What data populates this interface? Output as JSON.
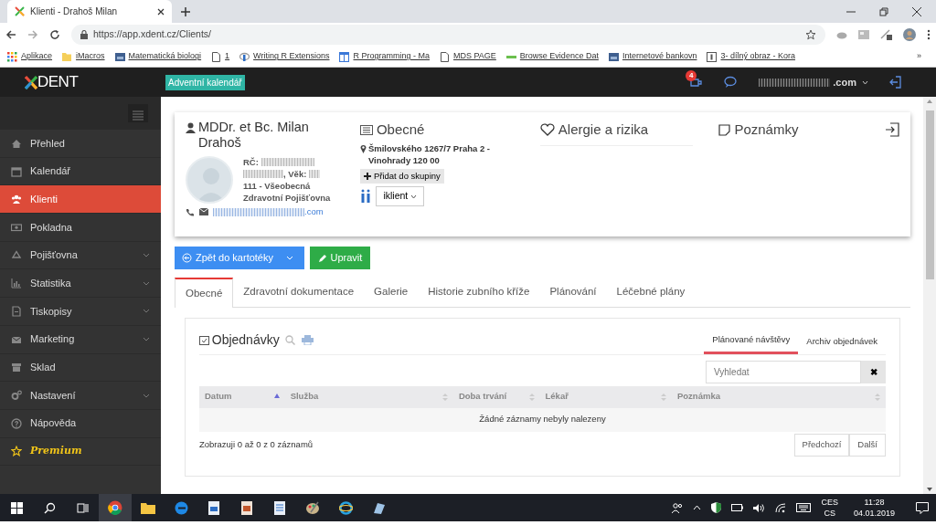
{
  "browser": {
    "tab_title": "Klienti - Drahoš Milan",
    "url": "https://app.xdent.cz/Clients/",
    "bookmarks": [
      "Aplikace",
      "iMacros",
      "Matematická biologi",
      "1",
      "Writing R Extensions",
      "R Programming - Ma",
      "MDS PAGE",
      "Browse Evidence Dat",
      "Internetové bankovn",
      "3- dílný obraz - Kora"
    ],
    "overflow": "»"
  },
  "app": {
    "logo_text": "DENT",
    "banner": "Adventní kalendář",
    "notification_count": "4",
    "user_suffix": ".com"
  },
  "sidebar": {
    "items": [
      {
        "label": "Přehled",
        "selected": false,
        "expandable": false
      },
      {
        "label": "Kalendář",
        "selected": false,
        "expandable": false
      },
      {
        "label": "Klienti",
        "selected": true,
        "expandable": false
      },
      {
        "label": "Pokladna",
        "selected": false,
        "expandable": false
      },
      {
        "label": "Pojišťovna",
        "selected": false,
        "expandable": true
      },
      {
        "label": "Statistika",
        "selected": false,
        "expandable": true
      },
      {
        "label": "Tiskopisy",
        "selected": false,
        "expandable": true
      },
      {
        "label": "Marketing",
        "selected": false,
        "expandable": true
      },
      {
        "label": "Sklad",
        "selected": false,
        "expandable": false
      },
      {
        "label": "Nastavení",
        "selected": false,
        "expandable": true
      },
      {
        "label": "Nápověda",
        "selected": false,
        "expandable": false
      },
      {
        "label": "Premium",
        "selected": false,
        "expandable": false,
        "kind": "premium"
      }
    ]
  },
  "client": {
    "name": "MDDr. et Bc. Milan Drahoš",
    "rc_label": "RČ:",
    "age_label": ", Věk:",
    "insurance": "111 - Všeobecná Zdravotní Pojišťovna",
    "email_suffix": ".com",
    "general": {
      "heading": "Obecné",
      "address": "Šmilovského 1267/7 Praha 2 - Vinohrady 120 00",
      "group_button": "Přidat do skupiny",
      "client_type": "iklient"
    },
    "allergies": {
      "heading": "Alergie a rizika"
    },
    "notes": {
      "heading": "Poznámky"
    }
  },
  "actions": {
    "back": "Zpět do kartotéky",
    "edit": "Upravit"
  },
  "tabs": [
    {
      "label": "Obecné",
      "selected": true
    },
    {
      "label": "Zdravotní dokumentace",
      "selected": false
    },
    {
      "label": "Galerie",
      "selected": false
    },
    {
      "label": "Historie zubního kříže",
      "selected": false
    },
    {
      "label": "Plánování",
      "selected": false
    },
    {
      "label": "Léčebné plány",
      "selected": false
    }
  ],
  "orders": {
    "title": "Objednávky",
    "subtabs": [
      {
        "label": "Plánované návštěvy",
        "selected": true
      },
      {
        "label": "Archiv objednávek",
        "selected": false
      }
    ],
    "search": {
      "placeholder": "Vyhledat"
    },
    "clear": "✖",
    "table": {
      "columns": [
        {
          "label": "Datum",
          "sorted": true
        },
        {
          "label": "Služba",
          "sorted": false
        },
        {
          "label": "Doba trvání",
          "sorted": false
        },
        {
          "label": "Lékař",
          "sorted": false
        },
        {
          "label": "Poznámka",
          "sorted": false
        }
      ],
      "empty": "Žádné záznamy nebyly nalezeny"
    },
    "info": "Zobrazuji 0 až 0 z 0 záznamů",
    "pagination": [
      "Předchozí",
      "Další"
    ]
  },
  "taskbar": {
    "lang_top": "CES",
    "lang_bottom": "CS",
    "time": "11:28",
    "date": "04.01.2019"
  }
}
